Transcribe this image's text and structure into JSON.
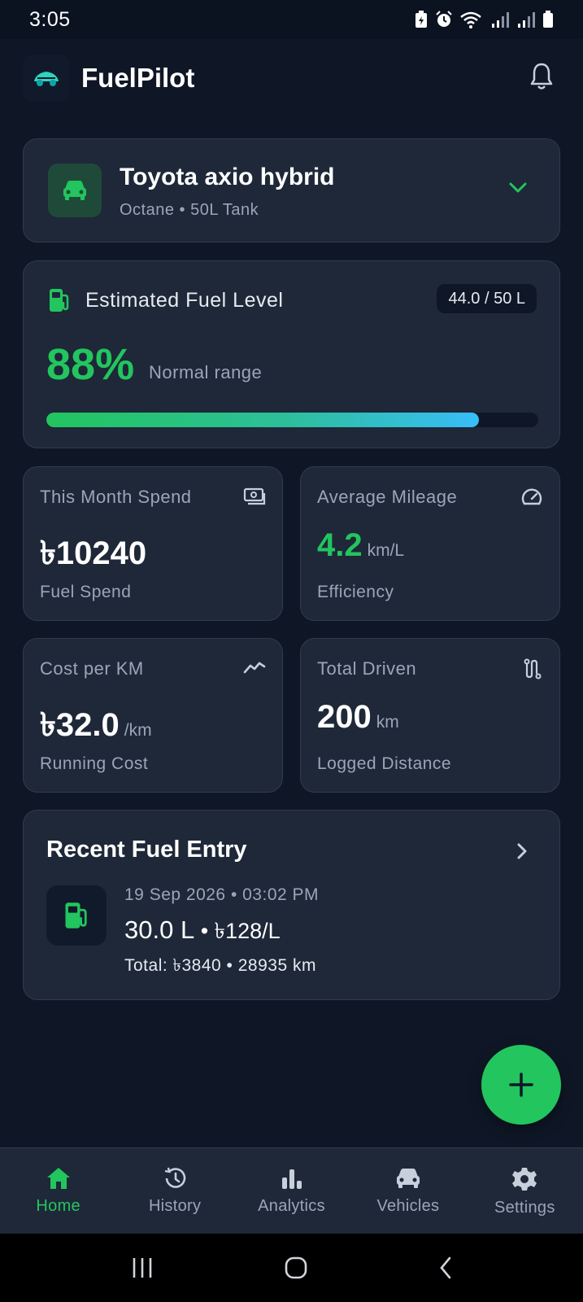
{
  "status_bar": {
    "time": "3:05"
  },
  "app": {
    "title": "FuelPilot"
  },
  "vehicle": {
    "name": "Toyota axio hybrid",
    "details": "Octane • 50L Tank"
  },
  "fuel_level": {
    "title": "Estimated Fuel Level",
    "capacity": "44.0 / 50 L",
    "percent_text": "88%",
    "status": "Normal range",
    "fraction": 0.88
  },
  "stats": {
    "month_spend": {
      "label": "This Month Spend",
      "value": "৳10240",
      "sub": "Fuel Spend"
    },
    "avg_mileage": {
      "label": "Average Mileage",
      "value": "4.2",
      "unit": "km/L",
      "sub": "Efficiency"
    },
    "cost_per_km": {
      "label": "Cost per KM",
      "value": "৳32.0",
      "unit": "/km",
      "sub": "Running Cost"
    },
    "total_driven": {
      "label": "Total Driven",
      "value": "200",
      "unit": "km",
      "sub": "Logged Distance"
    }
  },
  "recent_entry": {
    "title": "Recent Fuel Entry",
    "date": "19 Sep 2026 • 03:02 PM",
    "liters": "30.0 L",
    "rate": " • ৳128/L",
    "total": "Total: ৳3840 • 28935 km"
  },
  "bottom_nav": {
    "home": "Home",
    "history": "History",
    "analytics": "Analytics",
    "vehicles": "Vehicles",
    "settings": "Settings"
  },
  "colors": {
    "accent": "#22c55e",
    "accent_blue": "#38bdf8",
    "card": "#1e2838",
    "background": "#0f1726"
  }
}
